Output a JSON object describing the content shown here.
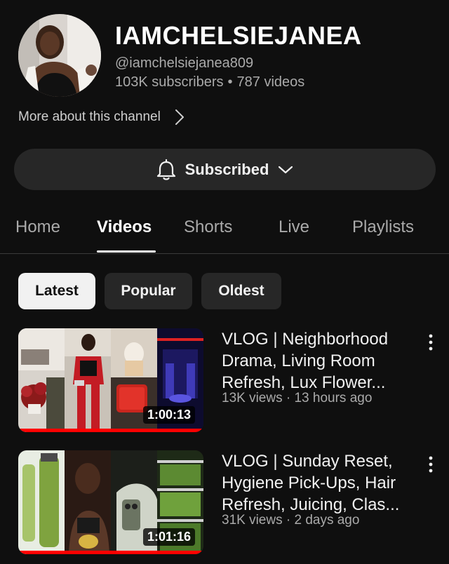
{
  "channel": {
    "name": "IAMCHELSIEJANEA",
    "handle": "@iamchelsiejanea809",
    "subscribers": "103K subscribers",
    "separator": "•",
    "video_count": "787 videos",
    "more_about": "More about this channel"
  },
  "subscribe": {
    "label": "Subscribed",
    "icon": "bell-icon",
    "dropdown_icon": "chevron-down-icon"
  },
  "tabs": [
    {
      "label": "Home",
      "active": false
    },
    {
      "label": "Videos",
      "active": true
    },
    {
      "label": "Shorts",
      "active": false
    },
    {
      "label": "Live",
      "active": false
    },
    {
      "label": "Playlists",
      "active": false
    }
  ],
  "filters": [
    {
      "label": "Latest",
      "active": true
    },
    {
      "label": "Popular",
      "active": false
    },
    {
      "label": "Oldest",
      "active": false
    }
  ],
  "videos": [
    {
      "title": "VLOG | Neighborhood Drama, Living Room Refresh, Lux Flower...",
      "meta": "13K views · 13 hours ago",
      "duration": "1:00:13",
      "watched_fraction": 1.0
    },
    {
      "title": "VLOG | Sunday Reset, Hygiene Pick-Ups, Hair Refresh, Juicing, Clas...",
      "meta": "31K views · 2 days ago",
      "duration": "1:01:16",
      "watched_fraction": 1.0
    }
  ],
  "colors": {
    "background": "#0f0f0f",
    "surface": "#272727",
    "accent_progress": "#ff0000",
    "text_primary": "#f1f1f1",
    "text_secondary": "#aaaaaa"
  }
}
